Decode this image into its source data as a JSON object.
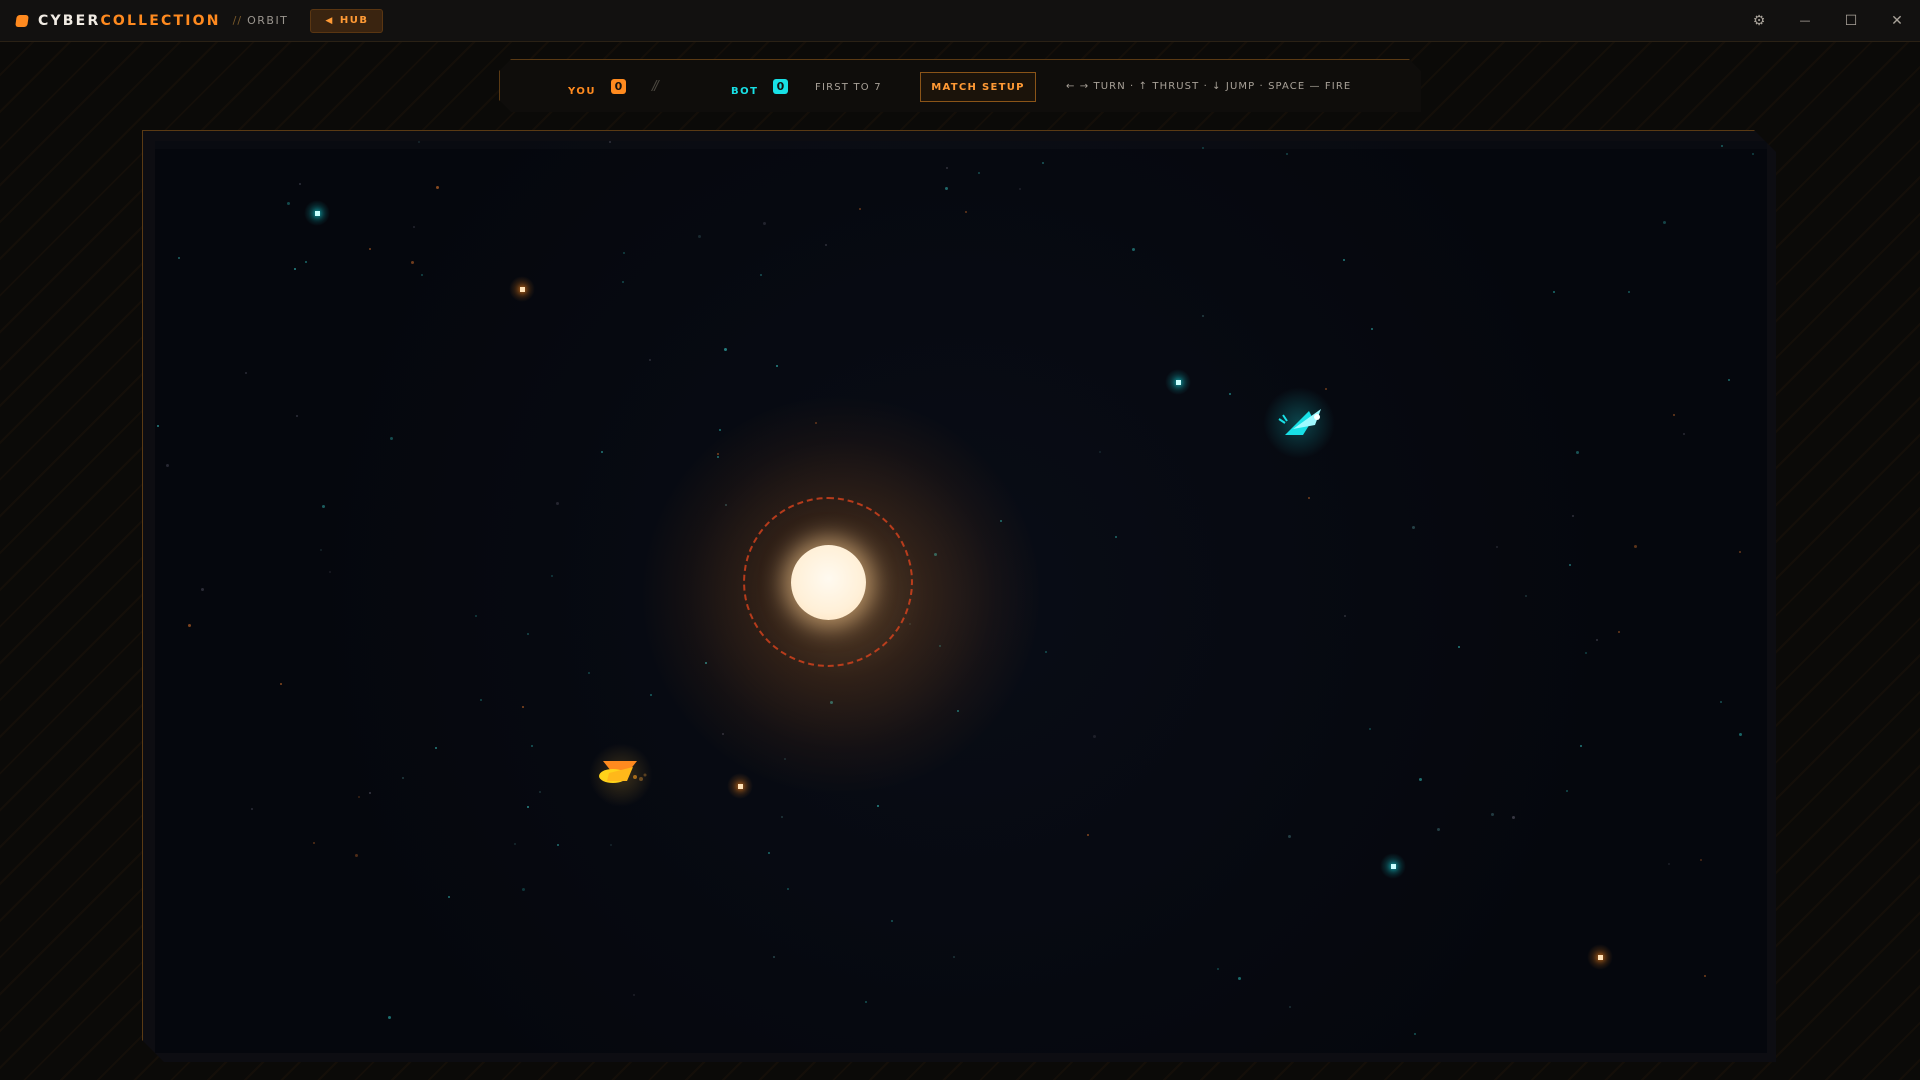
{
  "app": {
    "brand_primary": "CYBER",
    "brand_accent": "COLLECTION",
    "crumb_sep": "//",
    "crumb": "ORBIT",
    "hub_label": "HUB",
    "hub_icon": "◀"
  },
  "window": {
    "settings_icon": "⚙",
    "minimize_icon": "—",
    "maximize_icon": "☐",
    "close_icon": "✕"
  },
  "hud": {
    "player_label": "YOU",
    "player_score": "0",
    "vs": "//",
    "bot_label": "BOT",
    "bot_score": "0",
    "goal": "FIRST TO 7",
    "setup_button": "MATCH SETUP",
    "controls": "← → TURN · ↑ THRUST · ↓ JUMP · SPACE — FIRE"
  },
  "colors": {
    "accent_orange": "#ff8a1f",
    "accent_cyan": "#18e0e6",
    "player_ship": "#ffd21a",
    "sun": "#fff5e6"
  },
  "arena": {
    "entities": [
      {
        "type": "sun",
        "name": "sun"
      },
      {
        "type": "ship",
        "name": "player-ship",
        "team": "player"
      },
      {
        "type": "ship",
        "name": "bot-ship",
        "team": "bot"
      },
      {
        "type": "projectile",
        "team": "bot"
      },
      {
        "type": "projectile",
        "team": "player"
      },
      {
        "type": "projectile",
        "team": "bot"
      },
      {
        "type": "projectile",
        "team": "player"
      },
      {
        "type": "projectile",
        "team": "bot"
      },
      {
        "type": "projectile",
        "team": "player"
      }
    ]
  }
}
